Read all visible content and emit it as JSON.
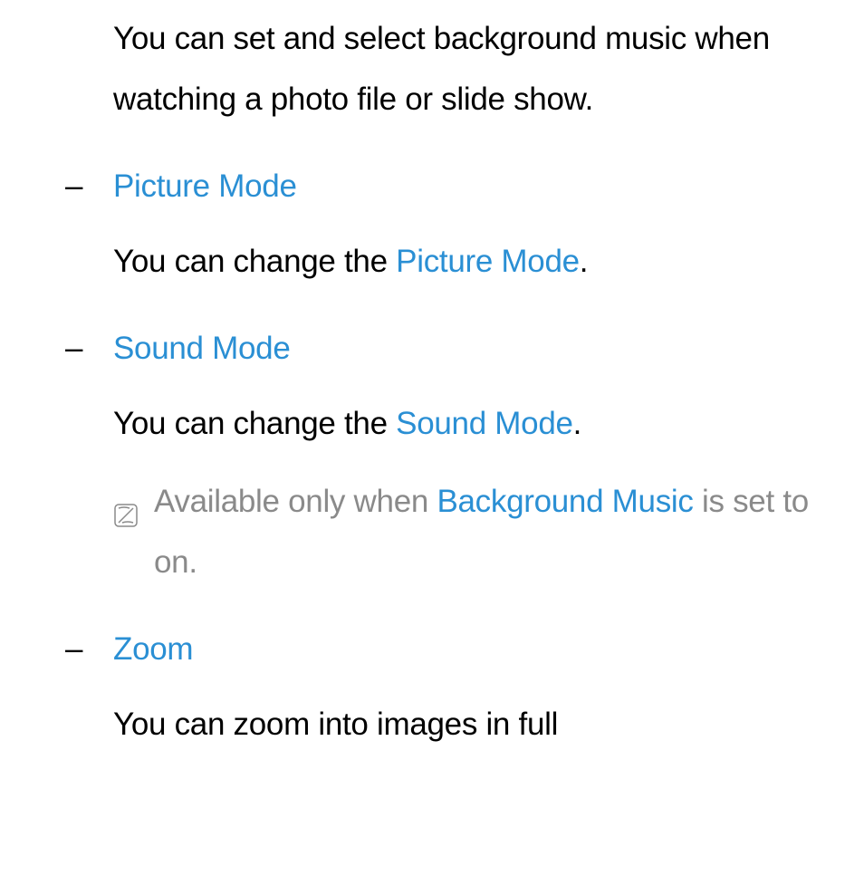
{
  "intro": "You can set and select background music when watching a photo file or slide show.",
  "items": [
    {
      "title": "Picture Mode",
      "description_prefix": "You can change the ",
      "description_highlight": "Picture Mode",
      "description_suffix": "."
    },
    {
      "title": "Sound Mode",
      "description_prefix": "You can change the ",
      "description_highlight": "Sound Mode",
      "description_suffix": ".",
      "note_prefix": "Available only when ",
      "note_highlight": "Background Music",
      "note_suffix": " is set to on."
    },
    {
      "title": "Zoom",
      "description_prefix": "You can zoom into images in full",
      "description_highlight": "",
      "description_suffix": ""
    }
  ],
  "bullet": "–"
}
